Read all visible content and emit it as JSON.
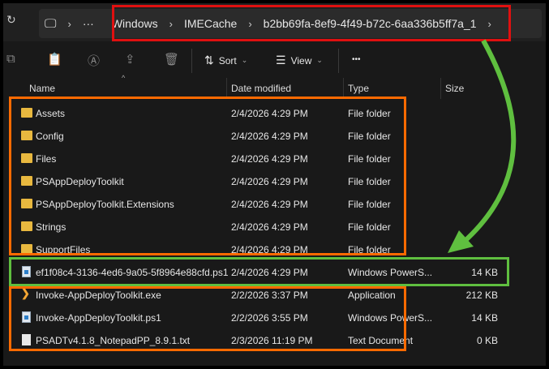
{
  "breadcrumb": {
    "items": [
      "Windows",
      "IMECache",
      "b2bb69fa-8ef9-4f49-b72c-6aa336b5ff7a_1"
    ],
    "overflow": "···"
  },
  "toolbar": {
    "sort_label": "Sort",
    "view_label": "View",
    "more_label": "•••"
  },
  "columns": {
    "name": "Name",
    "date": "Date modified",
    "type": "Type",
    "size": "Size"
  },
  "files": [
    {
      "name": "Assets",
      "date": "2/4/2026 4:29 PM",
      "type": "File folder",
      "size": "",
      "icon": "folder-icon"
    },
    {
      "name": "Config",
      "date": "2/4/2026 4:29 PM",
      "type": "File folder",
      "size": "",
      "icon": "folder-icon"
    },
    {
      "name": "Files",
      "date": "2/4/2026 4:29 PM",
      "type": "File folder",
      "size": "",
      "icon": "folder-icon"
    },
    {
      "name": "PSAppDeployToolkit",
      "date": "2/4/2026 4:29 PM",
      "type": "File folder",
      "size": "",
      "icon": "folder-icon"
    },
    {
      "name": "PSAppDeployToolkit.Extensions",
      "date": "2/4/2026 4:29 PM",
      "type": "File folder",
      "size": "",
      "icon": "folder-icon"
    },
    {
      "name": "Strings",
      "date": "2/4/2026 4:29 PM",
      "type": "File folder",
      "size": "",
      "icon": "folder-icon"
    },
    {
      "name": "SupportFiles",
      "date": "2/4/2026 4:29 PM",
      "type": "File folder",
      "size": "",
      "icon": "folder-icon"
    },
    {
      "name": "ef1f08c4-3136-4ed6-9a05-5f8964e88cfd.ps1",
      "date": "2/4/2026 4:29 PM",
      "type": "Windows PowerS...",
      "size": "14 KB",
      "icon": "powershell-file-icon"
    },
    {
      "name": "Invoke-AppDeployToolkit.exe",
      "date": "2/2/2026 3:37 PM",
      "type": "Application",
      "size": "212 KB",
      "icon": "application-icon"
    },
    {
      "name": "Invoke-AppDeployToolkit.ps1",
      "date": "2/2/2026 3:55 PM",
      "type": "Windows PowerS...",
      "size": "14 KB",
      "icon": "powershell-file-icon"
    },
    {
      "name": "PSADTv4.1.8_NotepadPP_8.9.1.txt",
      "date": "2/3/2026 11:19 PM",
      "type": "Text Document",
      "size": "0 KB",
      "icon": "text-file-icon"
    }
  ],
  "annotation_colors": {
    "red": "#e01010",
    "orange": "#ff6a00",
    "green": "#5fbf3f"
  }
}
